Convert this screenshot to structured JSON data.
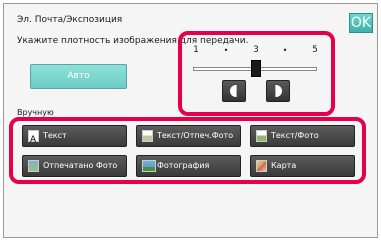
{
  "header": {
    "title": "Эл. Почта/Экспозиция",
    "ok_label": "OK"
  },
  "instruction": "Укажите плотность изображения для передачи.",
  "auto_label": "Авто",
  "manual_label": "Вручную",
  "density": {
    "scale": [
      "1",
      "•",
      "3",
      "•",
      "5"
    ],
    "value": 3,
    "min": 1,
    "max": 5
  },
  "modes": [
    {
      "label": "Текст",
      "icon": "text-mode-icon"
    },
    {
      "label": "Текст/Отпеч.Фото",
      "icon": "text-printed-photo-icon"
    },
    {
      "label": "Текст/Фото",
      "icon": "text-photo-icon"
    },
    {
      "label": "Отпечатано Фото",
      "icon": "printed-photo-icon"
    },
    {
      "label": "Фотография",
      "icon": "photo-icon"
    },
    {
      "label": "Карта",
      "icon": "map-icon"
    }
  ],
  "colors": {
    "highlight": "#e6004c",
    "accent": "#3fb0ab"
  }
}
